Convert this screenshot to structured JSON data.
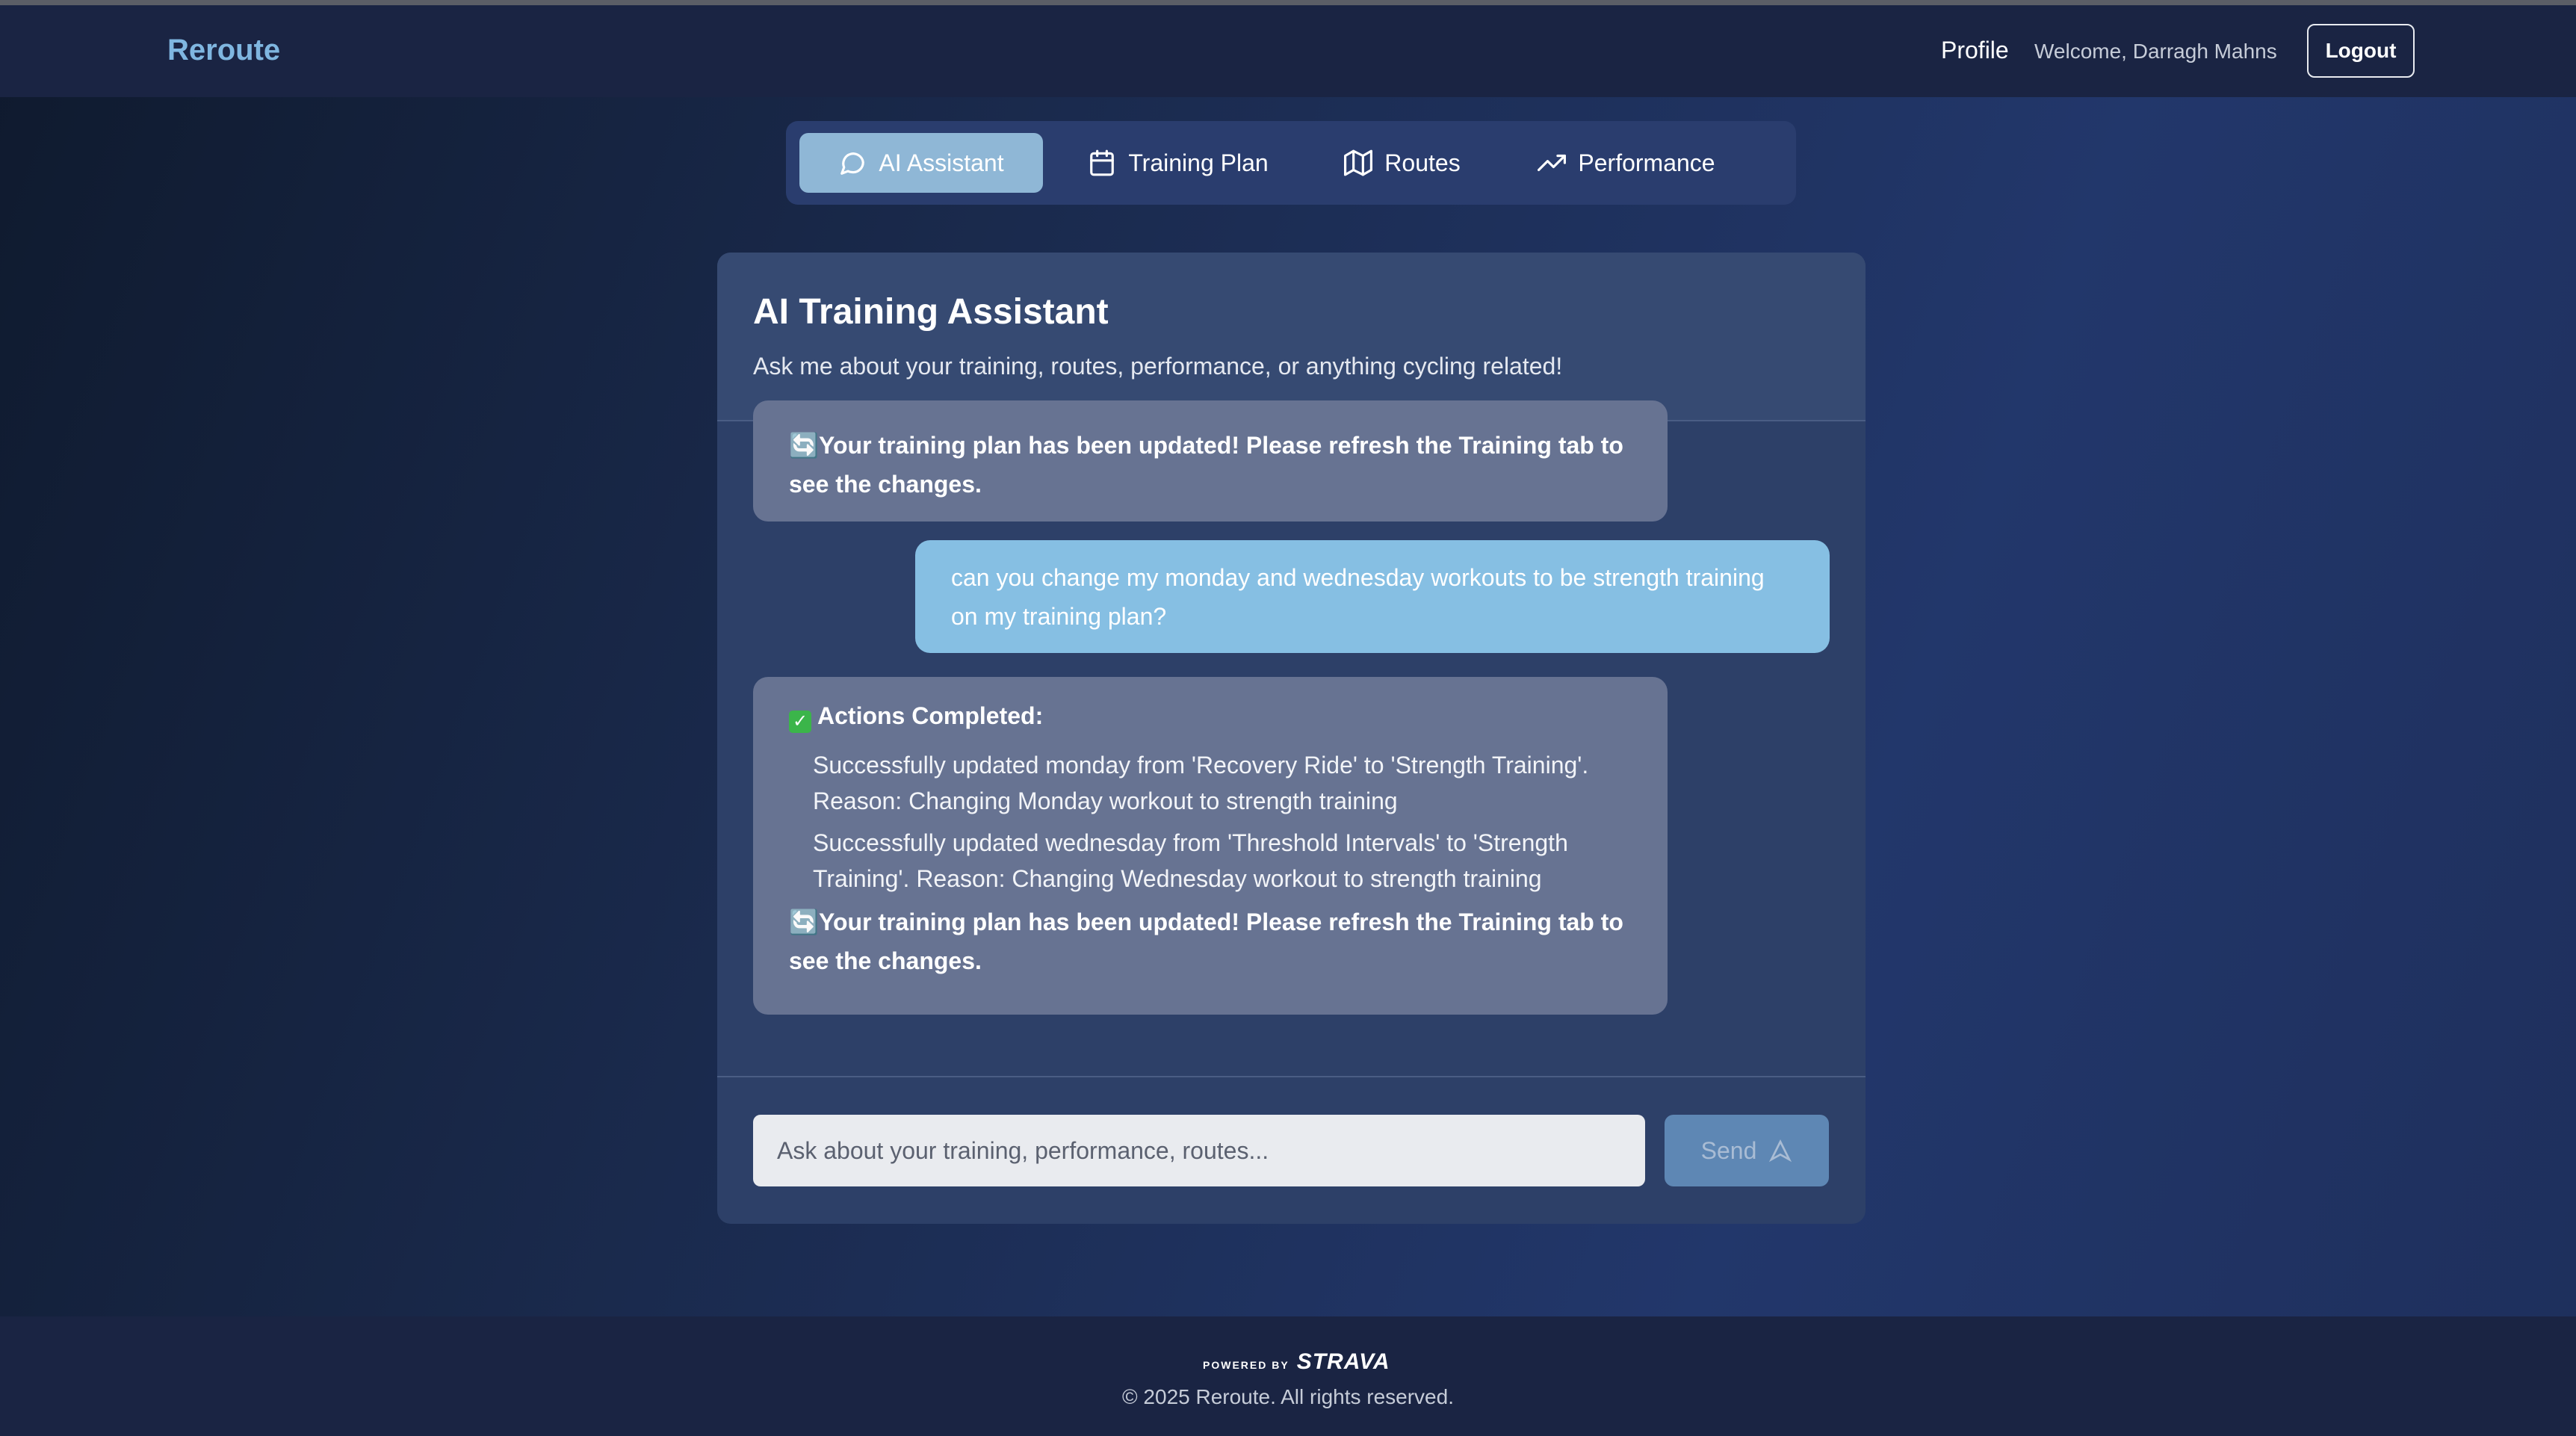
{
  "header": {
    "brand": "Reroute",
    "profile_label": "Profile",
    "welcome_text": "Welcome, Darragh Mahns",
    "logout_label": "Logout"
  },
  "tabs": [
    {
      "label": "AI Assistant",
      "icon": "message-circle-icon",
      "active": true
    },
    {
      "label": "Training Plan",
      "icon": "calendar-icon",
      "active": false
    },
    {
      "label": "Routes",
      "icon": "map-icon",
      "active": false
    },
    {
      "label": "Performance",
      "icon": "trending-up-icon",
      "active": false
    }
  ],
  "assistant": {
    "title": "AI Training Assistant",
    "subtitle": "Ask me about your training, routes, performance, or anything cycling related!"
  },
  "messages": [
    {
      "role": "assistant",
      "notice": "Your training plan has been updated! Please refresh the Training tab to see the changes."
    },
    {
      "role": "user",
      "text": "can you change my monday and wednesday workouts to be strength training on my training plan?"
    },
    {
      "role": "assistant",
      "heading": "Actions Completed:",
      "actions": [
        "Successfully updated monday from 'Recovery Ride' to 'Strength Training'. Reason: Changing Monday workout to strength training",
        "Successfully updated wednesday from 'Threshold Intervals' to 'Strength Training'. Reason: Changing Wednesday workout to strength training"
      ],
      "notice": "Your training plan has been updated! Please refresh the Training tab to see the changes."
    }
  ],
  "composer": {
    "placeholder": "Ask about your training, performance, routes...",
    "value": "",
    "send_label": "Send"
  },
  "footer": {
    "powered_by": "POWERED BY",
    "strava": "STRAVA",
    "copyright": "© 2025 Reroute. All rights reserved."
  },
  "colors": {
    "brand": "#7fb6e0",
    "active_tab": "#8fb7d6",
    "user_bubble": "#86bfe3",
    "assistant_bubble": "#677392",
    "send_button": "#5e87b4"
  }
}
